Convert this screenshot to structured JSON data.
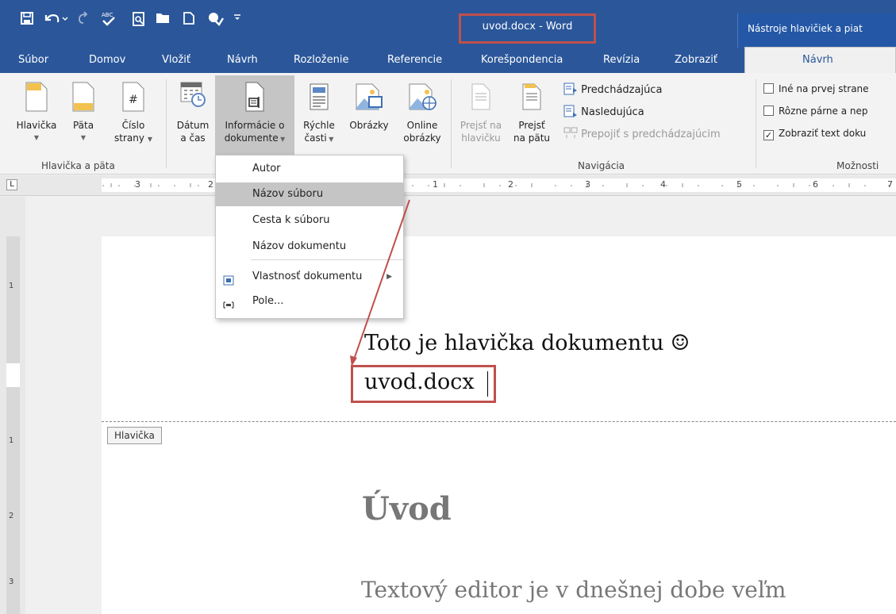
{
  "titlebar": {
    "title": "uvod.docx - Word",
    "context_title": "Nástroje hlavičiek a piat",
    "bg_color": "#2b579a",
    "highlight_color": "#c0504d",
    "quick_access": [
      "save-icon",
      "undo-icon",
      "redo-icon",
      "spelling-icon",
      "print-preview-icon",
      "open-icon",
      "new-icon",
      "touch-mode-icon",
      "customize-icon"
    ]
  },
  "tabs": [
    "Súbor",
    "Domov",
    "Vložiť",
    "Návrh",
    "Rozloženie",
    "Referencie",
    "Korešpondencia",
    "Revízia",
    "Zobraziť"
  ],
  "context_tab": "Návrh",
  "ribbon": {
    "header_footer": {
      "header": "Hlavička",
      "footer": "Päta",
      "page_number_1": "Číslo",
      "page_number_2": "strany",
      "group_label": "Hlavička a päta"
    },
    "insert": {
      "date_1": "Dátum",
      "date_2": "a čas",
      "docinfo_1": "Informácie o",
      "docinfo_2": "dokumente",
      "quick_1": "Rýchle",
      "quick_2": "časti",
      "pictures": "Obrázky",
      "online_1": "Online",
      "online_2": "obrázky"
    },
    "navigation": {
      "goto_header_1": "Prejsť na",
      "goto_header_2": "hlavičku",
      "goto_footer_1": "Prejsť",
      "goto_footer_2": "na pätu",
      "previous": "Predchádzajúca",
      "next": "Nasledujúca",
      "link_previous": "Prepojiť s predchádzajúcim",
      "group_label": "Navigácia"
    },
    "options": {
      "different_first": "Iné na prvej strane",
      "different_odd_even": "Rôzne párne a nep",
      "show_text": "Zobraziť text doku",
      "show_text_checked": true,
      "group_label": "Možnosti"
    }
  },
  "ruler": {
    "left_numbers": [
      "3",
      "2"
    ],
    "right_numbers": [
      "1",
      "2",
      "3",
      "4",
      "5",
      "6",
      "7"
    ],
    "vertical_numbers": [
      "1",
      "1",
      "2",
      "3"
    ],
    "corner": "L"
  },
  "dropdown": {
    "items": [
      "Autor",
      "Názov súboru",
      "Cesta k súboru",
      "Názov dokumentu",
      "Vlastnosť dokumentu",
      "Pole..."
    ],
    "highlighted_index": 1
  },
  "document": {
    "header_line1": "Toto je hlavička dokumentu ☺",
    "header_line2": "uvod.docx",
    "header_tag": "Hlavička",
    "heading": "Úvod",
    "body": "Textový editor je v dnešnej dobe veľm"
  }
}
